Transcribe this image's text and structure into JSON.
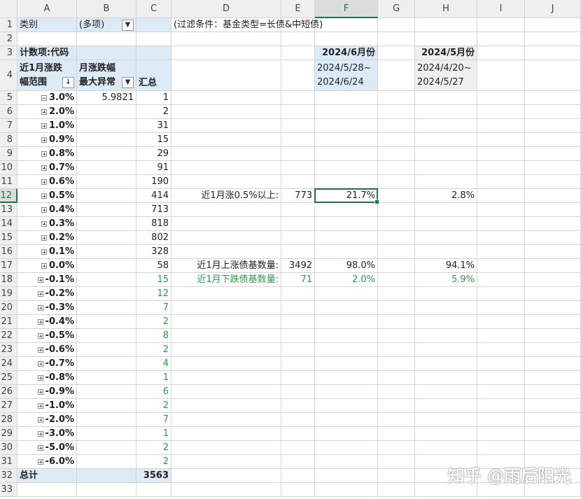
{
  "columns": [
    "A",
    "B",
    "C",
    "D",
    "E",
    "F",
    "G",
    "H",
    "I",
    "J"
  ],
  "selected_column": "F",
  "selected_row": 12,
  "watermark": "知乎 @雨后阳光",
  "cells": {
    "A1": "类别",
    "B1": "(多项)",
    "D1": "(过滤条件：基金类型=长债&中短债)",
    "A3": "计数项:代码",
    "A4a": "近1月涨跌",
    "A4b": "幅范围",
    "B4a": "月涨跌幅",
    "B4b": "最大异常",
    "C4": "汇总",
    "F3": "2024/6月份",
    "F4a": "2024/5/28~",
    "F4b": "2024/6/24",
    "H3": "2024/5月份",
    "H4a": "2024/4/20~",
    "H4b": "2024/5/27",
    "B5": "5.9821",
    "D12": "近1月涨0.5%以上:",
    "E12": "773",
    "F12": "21.7%",
    "H12": "2.8%",
    "D17": "近1月上涨债基数量:",
    "E17": "3492",
    "F17": "98.0%",
    "H17": "94.1%",
    "D18": "近1月下跌债基数量:",
    "E18": "71",
    "F18": "2.0%",
    "H18": "5.9%",
    "A32": "总计",
    "C32": "3563"
  },
  "pivot_rows": [
    {
      "label": "3.0%",
      "count": "1",
      "expanded": true
    },
    {
      "label": "2.0%",
      "count": "2"
    },
    {
      "label": "1.0%",
      "count": "31"
    },
    {
      "label": "0.9%",
      "count": "15"
    },
    {
      "label": "0.8%",
      "count": "29"
    },
    {
      "label": "0.7%",
      "count": "91"
    },
    {
      "label": "0.6%",
      "count": "190"
    },
    {
      "label": "0.5%",
      "count": "414"
    },
    {
      "label": "0.4%",
      "count": "713"
    },
    {
      "label": "0.3%",
      "count": "818"
    },
    {
      "label": "0.2%",
      "count": "802"
    },
    {
      "label": "0.1%",
      "count": "328"
    },
    {
      "label": "0.0%",
      "count": "58"
    },
    {
      "label": "-0.1%",
      "count": "15",
      "neg": true
    },
    {
      "label": "-0.2%",
      "count": "12",
      "neg": true
    },
    {
      "label": "-0.3%",
      "count": "7",
      "neg": true
    },
    {
      "label": "-0.4%",
      "count": "2",
      "neg": true
    },
    {
      "label": "-0.5%",
      "count": "8",
      "neg": true
    },
    {
      "label": "-0.6%",
      "count": "2",
      "neg": true
    },
    {
      "label": "-0.7%",
      "count": "4",
      "neg": true
    },
    {
      "label": "-0.8%",
      "count": "1",
      "neg": true
    },
    {
      "label": "-0.9%",
      "count": "6",
      "neg": true
    },
    {
      "label": "-1.0%",
      "count": "2",
      "neg": true
    },
    {
      "label": "-2.0%",
      "count": "7",
      "neg": true
    },
    {
      "label": "-3.0%",
      "count": "1",
      "neg": true
    },
    {
      "label": "-5.0%",
      "count": "2",
      "neg": true
    },
    {
      "label": "-6.0%",
      "count": "2",
      "neg": true
    }
  ],
  "colors": {
    "accent": "#217346",
    "pivot_fill": "#ddebf7",
    "negative_text": "#2f9a47"
  }
}
